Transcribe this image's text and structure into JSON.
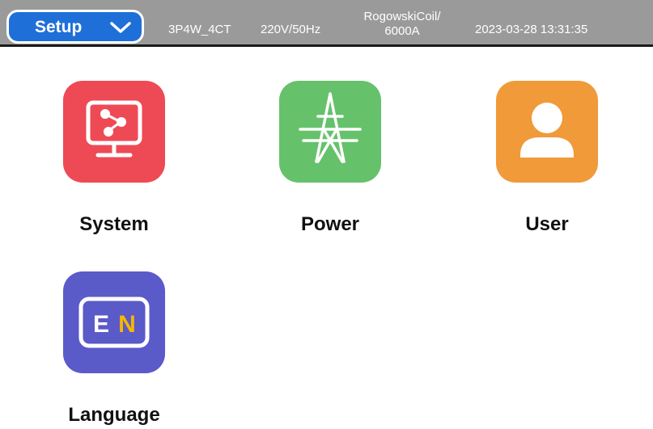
{
  "header": {
    "mode_label": "Setup",
    "wiring": "3P4W_4CT",
    "voltage": "220V/50Hz",
    "sensor_line1": "RogowskiCoil/",
    "sensor_line2": "6000A",
    "datetime": "2023-03-28 13:31:35"
  },
  "tiles": [
    {
      "label": "System",
      "icon": "monitor-network-icon",
      "color": "#ee4a55"
    },
    {
      "label": "Power",
      "icon": "power-tower-icon",
      "color": "#66c16b"
    },
    {
      "label": "User",
      "icon": "user-icon",
      "color": "#f09a3a"
    },
    {
      "label": "Language",
      "icon": "language-en-icon",
      "icon_text_1": "E",
      "icon_text_2": "N",
      "color": "#5b5ac9"
    }
  ],
  "colors": {
    "header_bg": "#9a9a9a",
    "mode_select_bg": "#1f6fd9",
    "language_accent": "#f5b800"
  }
}
